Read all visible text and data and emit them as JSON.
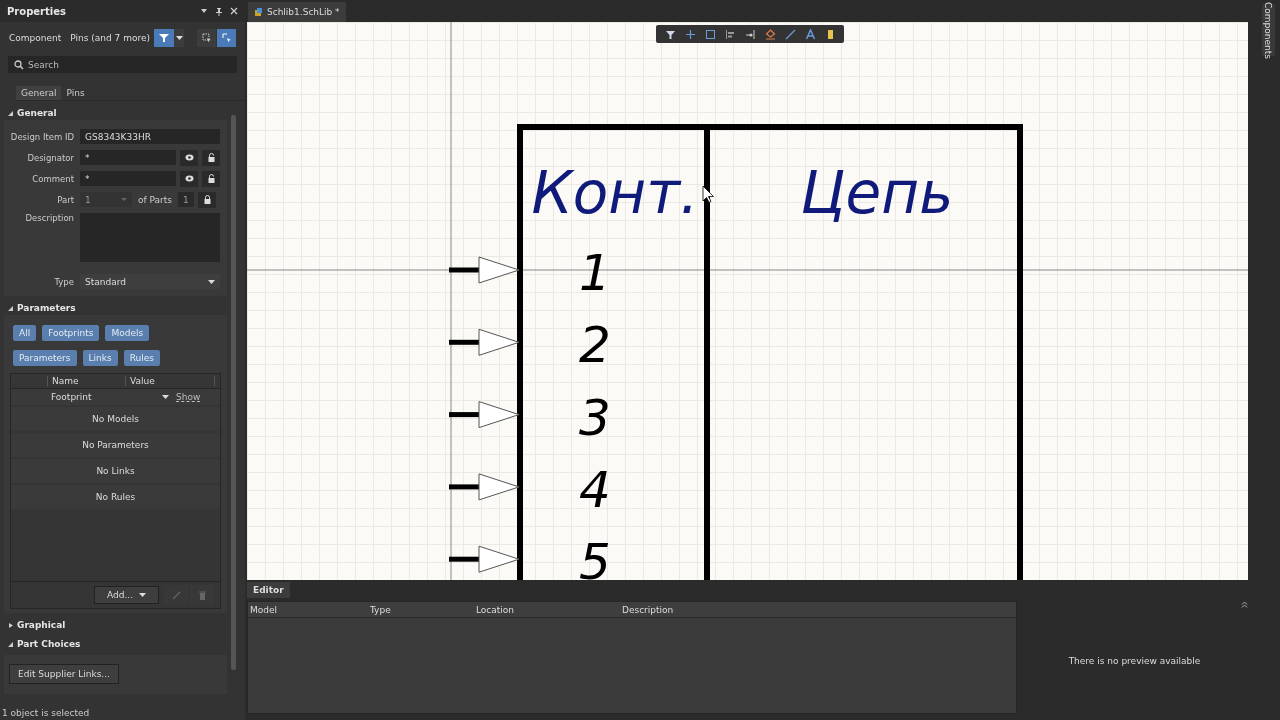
{
  "panel": {
    "title": "Properties",
    "component_label": "Component",
    "filter_text": "Pins (and 7 more)",
    "search": {
      "placeholder": "Search"
    },
    "tabs": [
      {
        "label": "General",
        "selected": true
      },
      {
        "label": "Pins",
        "selected": false
      }
    ],
    "general": {
      "title": "General",
      "expanded": true,
      "fields": [
        {
          "kind": "text",
          "label": "Design Item ID",
          "value": "GS8343K33HR"
        },
        {
          "kind": "locked",
          "label": "Designator",
          "value": "*"
        },
        {
          "kind": "locked",
          "label": "Comment",
          "value": "*"
        },
        {
          "kind": "part",
          "label": "Part",
          "value": "1",
          "disabled": true,
          "of_label": "of Parts",
          "of_value": "1"
        },
        {
          "kind": "area",
          "label": "Description"
        },
        {
          "kind": "select",
          "label": "Type",
          "value": "Standard"
        }
      ]
    },
    "parameters": {
      "title": "Parameters",
      "expanded": true,
      "filters": [
        {
          "label": "All"
        },
        {
          "label": "Footprints"
        },
        {
          "label": "Models"
        },
        {
          "label": "Parameters"
        },
        {
          "label": "Links"
        },
        {
          "label": "Rules"
        }
      ],
      "columns": [
        "Name",
        "Value"
      ],
      "footprint_row": {
        "name": "Footprint",
        "action": "Show"
      },
      "empty_rows": [
        "No Models",
        "No Parameters",
        "No Links",
        "No Rules"
      ],
      "add_button": "Add..."
    },
    "graphical": {
      "title": "Graphical",
      "expanded": false
    },
    "part_choices": {
      "title": "Part Choices",
      "expanded": true,
      "button": "Edit Supplier Links..."
    },
    "status": "1 object is selected"
  },
  "document_tab": {
    "label": "Schlib1.SchLib *"
  },
  "symbol": {
    "headers": [
      {
        "text": "Конт."
      },
      {
        "text": "Цепь"
      }
    ],
    "pins": [
      {
        "number": "1"
      },
      {
        "number": "2"
      },
      {
        "number": "3"
      },
      {
        "number": "4"
      },
      {
        "number": "5"
      }
    ]
  },
  "editor": {
    "tab": "Editor",
    "columns": [
      "Model",
      "Type",
      "Location",
      "Description"
    ],
    "preview_text": "There is no preview available"
  },
  "right_sidebar": {
    "tab": "Components"
  }
}
